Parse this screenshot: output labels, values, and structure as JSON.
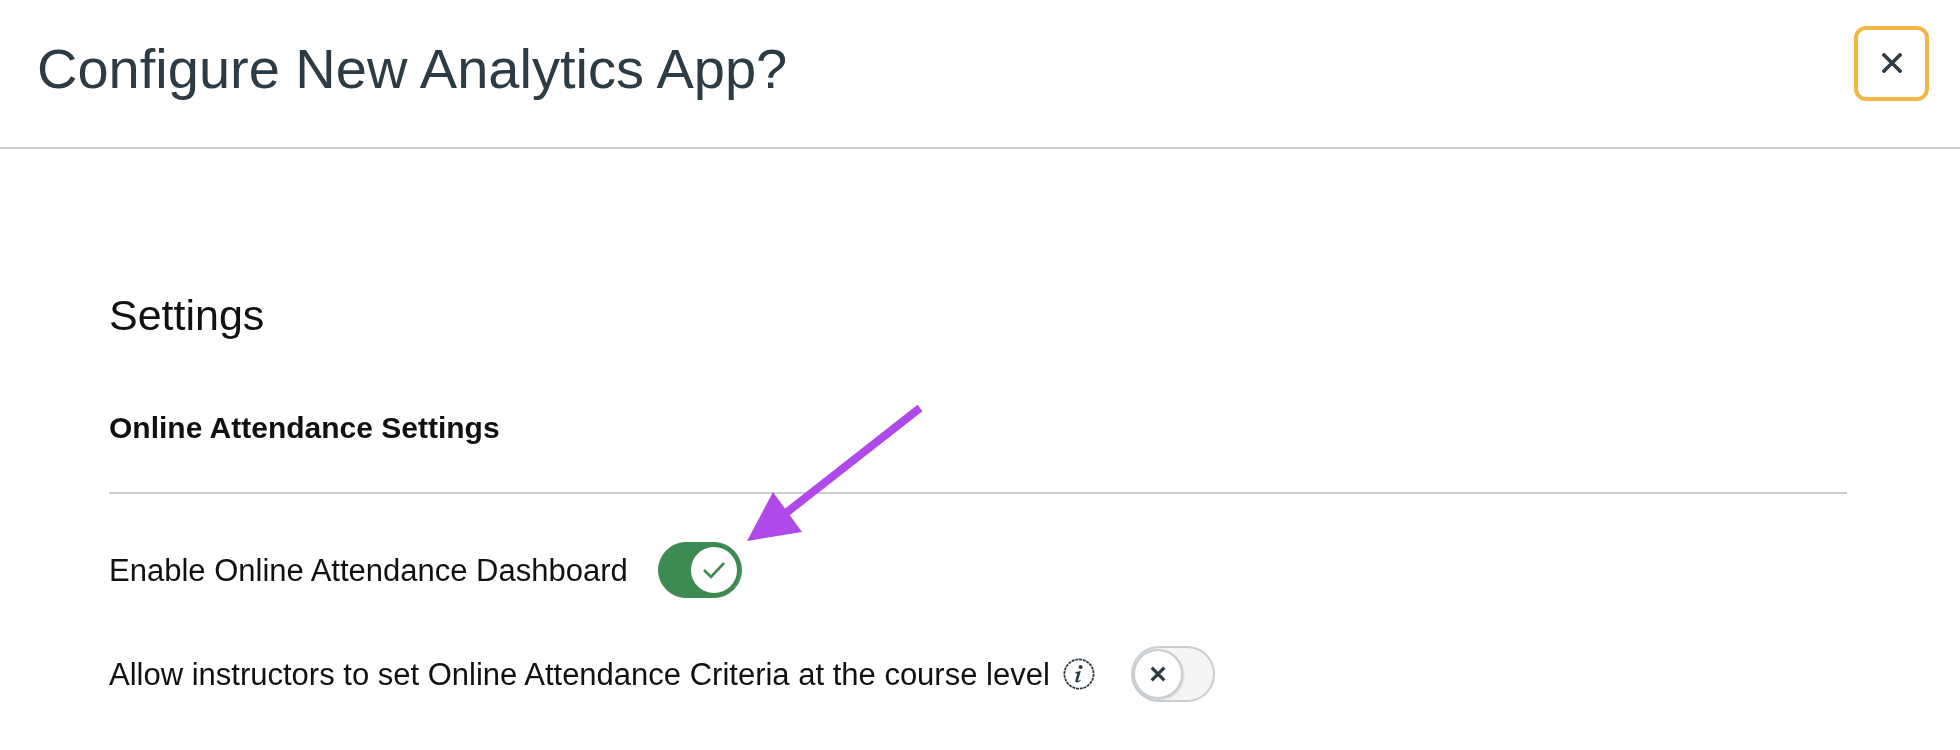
{
  "title": "Configure New Analytics App?",
  "section": {
    "heading": "Settings",
    "subheading": "Online Attendance Settings"
  },
  "settings": [
    {
      "label": "Enable Online Attendance Dashboard",
      "on": true,
      "info": false
    },
    {
      "label": "Allow instructors to set Online Attendance Criteria at the course level",
      "on": false,
      "info": true
    }
  ]
}
